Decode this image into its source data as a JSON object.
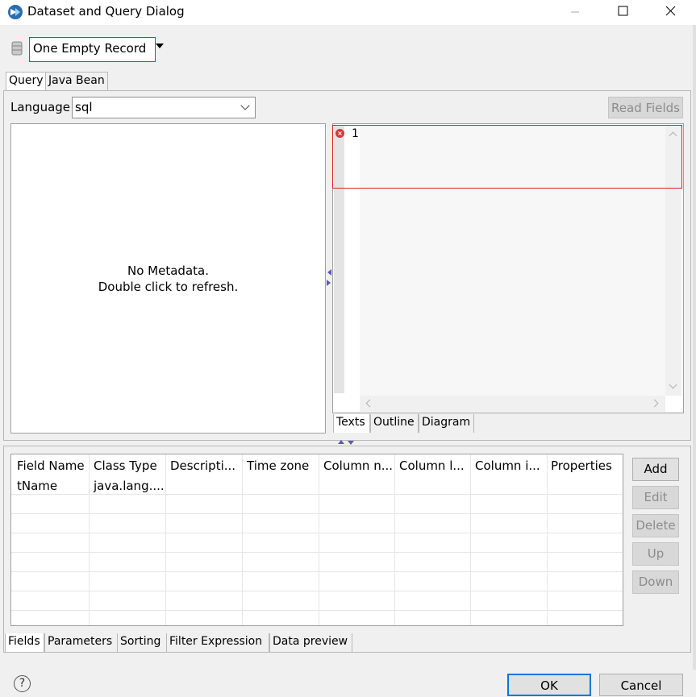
{
  "window": {
    "title": "Dataset and Query Dialog"
  },
  "datasource": {
    "selected": "One Empty Record"
  },
  "top_tabs": [
    {
      "label": "Query",
      "active": true
    },
    {
      "label": "Java Bean",
      "active": false
    }
  ],
  "query": {
    "language_label": "Language",
    "language_value": "sql",
    "read_fields_label": "Read Fields",
    "metadata_line1": "No Metadata.",
    "metadata_line2": "Double click to refresh.",
    "line_number": "1"
  },
  "editor_tabs": [
    {
      "label": "Texts",
      "active": true
    },
    {
      "label": "Outline",
      "active": false
    },
    {
      "label": "Diagram",
      "active": false
    }
  ],
  "fields_table": {
    "columns": [
      "Field Name",
      "Class Type",
      "Descripti...",
      "Time zone",
      "Column n...",
      "Column l...",
      "Column i...",
      "Properties"
    ],
    "rows": [
      [
        "tName",
        "java.lang....",
        "",
        "",
        "",
        "",
        "",
        ""
      ]
    ]
  },
  "side_buttons": {
    "add": "Add",
    "edit": "Edit",
    "delete": "Delete",
    "up": "Up",
    "down": "Down"
  },
  "bottom_tabs": [
    {
      "label": "Fields",
      "active": true
    },
    {
      "label": "Parameters",
      "active": false
    },
    {
      "label": "Sorting",
      "active": false
    },
    {
      "label": "Filter Expression",
      "active": false
    },
    {
      "label": "Data preview",
      "active": false
    }
  ],
  "footer": {
    "help_glyph": "?",
    "ok_label": "OK",
    "cancel_label": "Cancel"
  },
  "colors": {
    "highlight_border": "#e02020",
    "focus_border": "#0078d7"
  }
}
